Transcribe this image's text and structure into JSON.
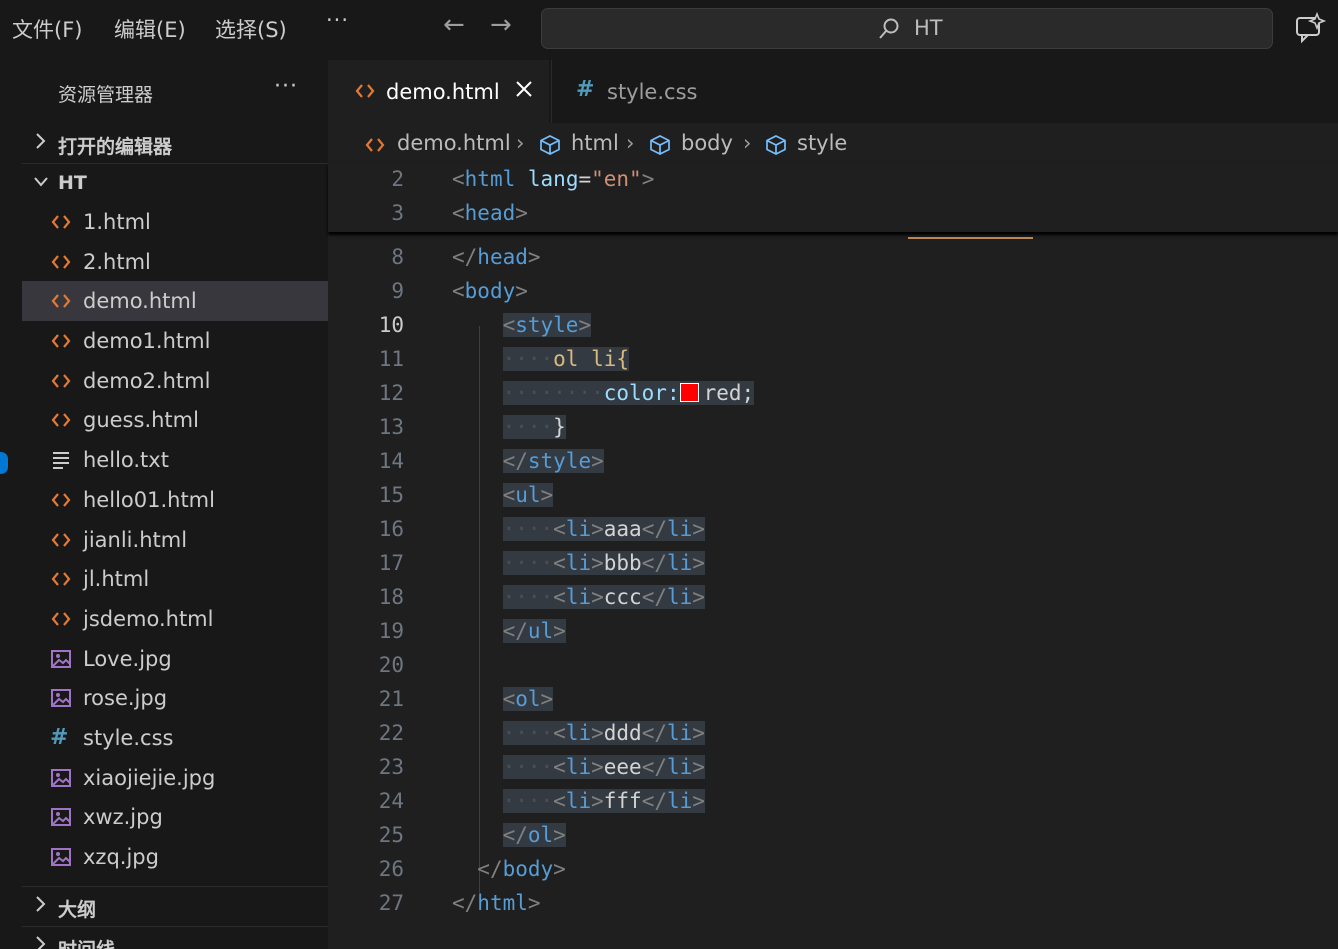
{
  "menu": {
    "file": "文件(F)",
    "edit": "编辑(E)",
    "select": "选择(S)",
    "more": "···"
  },
  "nav": {
    "back": "←",
    "forward": "→"
  },
  "search": {
    "text": "HT"
  },
  "sidebar": {
    "title": "资源管理器",
    "more": "···",
    "sections": {
      "open_editors": "打开的编辑器",
      "folder": "HT",
      "outline": "大纲",
      "timeline": "时间线"
    },
    "files": [
      {
        "name": "1.html",
        "type": "html-icon"
      },
      {
        "name": "2.html",
        "type": "html-icon"
      },
      {
        "name": "demo.html",
        "type": "html-icon"
      },
      {
        "name": "demo1.html",
        "type": "html-icon"
      },
      {
        "name": "demo2.html",
        "type": "html-icon"
      },
      {
        "name": "guess.html",
        "type": "html-icon"
      },
      {
        "name": "hello.txt",
        "type": "text-file-icon"
      },
      {
        "name": "hello01.html",
        "type": "html-icon"
      },
      {
        "name": "jianli.html",
        "type": "html-icon"
      },
      {
        "name": "jl.html",
        "type": "html-icon"
      },
      {
        "name": "jsdemo.html",
        "type": "html-icon"
      },
      {
        "name": "Love.jpg",
        "type": "image-icon"
      },
      {
        "name": "rose.jpg",
        "type": "image-icon"
      },
      {
        "name": "style.css",
        "type": "css-icon"
      },
      {
        "name": "xiaojiejie.jpg",
        "type": "image-icon"
      },
      {
        "name": "xwz.jpg",
        "type": "image-icon"
      },
      {
        "name": "xzq.jpg",
        "type": "image-icon"
      }
    ],
    "active_file": "demo.html"
  },
  "tabs": [
    {
      "label": "demo.html",
      "icon": "html-icon",
      "active": true,
      "close": "×"
    },
    {
      "label": "style.css",
      "icon": "css-icon",
      "active": false
    }
  ],
  "breadcrumb": [
    "demo.html",
    "html",
    "body",
    "style"
  ],
  "editor": {
    "current_line": "10",
    "lines": [
      {
        "n": "2"
      },
      {
        "n": "3"
      },
      {
        "n": "8"
      },
      {
        "n": "9"
      },
      {
        "n": "10"
      },
      {
        "n": "11"
      },
      {
        "n": "12"
      },
      {
        "n": "13"
      },
      {
        "n": "14"
      },
      {
        "n": "15"
      },
      {
        "n": "16"
      },
      {
        "n": "17"
      },
      {
        "n": "18"
      },
      {
        "n": "19"
      },
      {
        "n": "20"
      },
      {
        "n": "21"
      },
      {
        "n": "22"
      },
      {
        "n": "23"
      },
      {
        "n": "24"
      },
      {
        "n": "25"
      },
      {
        "n": "26"
      },
      {
        "n": "27"
      }
    ],
    "tokens": {
      "html": "html",
      "lang": "lang",
      "en": "\"en\"",
      "head": "head",
      "body": "body",
      "style": "style",
      "selector": "ol li{",
      "prop": "color:",
      "value": "red;",
      "brace": "}",
      "ul": "ul",
      "ol": "ol",
      "li": "li",
      "items": [
        "aaa",
        "bbb",
        "ccc",
        "ddd",
        "eee",
        "fff"
      ]
    },
    "swatch_color": "#ff0000"
  },
  "colors": {
    "accent": "#0078d4",
    "html_icon": "#e37933",
    "css_icon": "#519aba",
    "image_icon": "#a074c4"
  }
}
